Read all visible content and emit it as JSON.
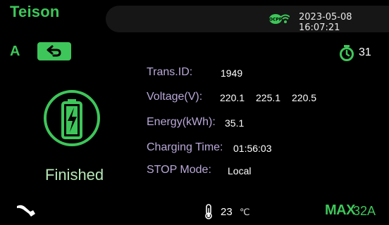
{
  "header": {
    "logo": "Teison",
    "datetime": "2023-05-08 16:07:21",
    "network_icon": "ocpp-wifi-icon"
  },
  "connector": {
    "label": "A",
    "back_icon": "back-arrow-icon"
  },
  "timer": {
    "icon": "stopwatch-icon",
    "value": "31"
  },
  "status": {
    "icon": "battery-charging-icon",
    "text": "Finished"
  },
  "info": {
    "trans_id": {
      "label": "Trans.ID:",
      "value": "1949"
    },
    "voltage": {
      "label": "Voltage(V):",
      "values": [
        "220.1",
        "225.1",
        "220.5"
      ]
    },
    "energy": {
      "label": "Energy(kWh):",
      "value": "35.1"
    },
    "charging_time": {
      "label": "Charging Time:",
      "value": "01:56:03"
    },
    "stop_mode": {
      "label": "STOP Mode:",
      "value": "Local"
    }
  },
  "footer": {
    "plug_icon": "charging-plug-icon",
    "temperature_icon": "thermometer-icon",
    "temperature_value": "23",
    "temperature_unit": "℃",
    "max_label": "MAX",
    "max_value": "32A"
  },
  "colors": {
    "accent": "#3ec65a",
    "label": "#b9a8d8",
    "background": "#000000",
    "topbar": "#161616"
  }
}
